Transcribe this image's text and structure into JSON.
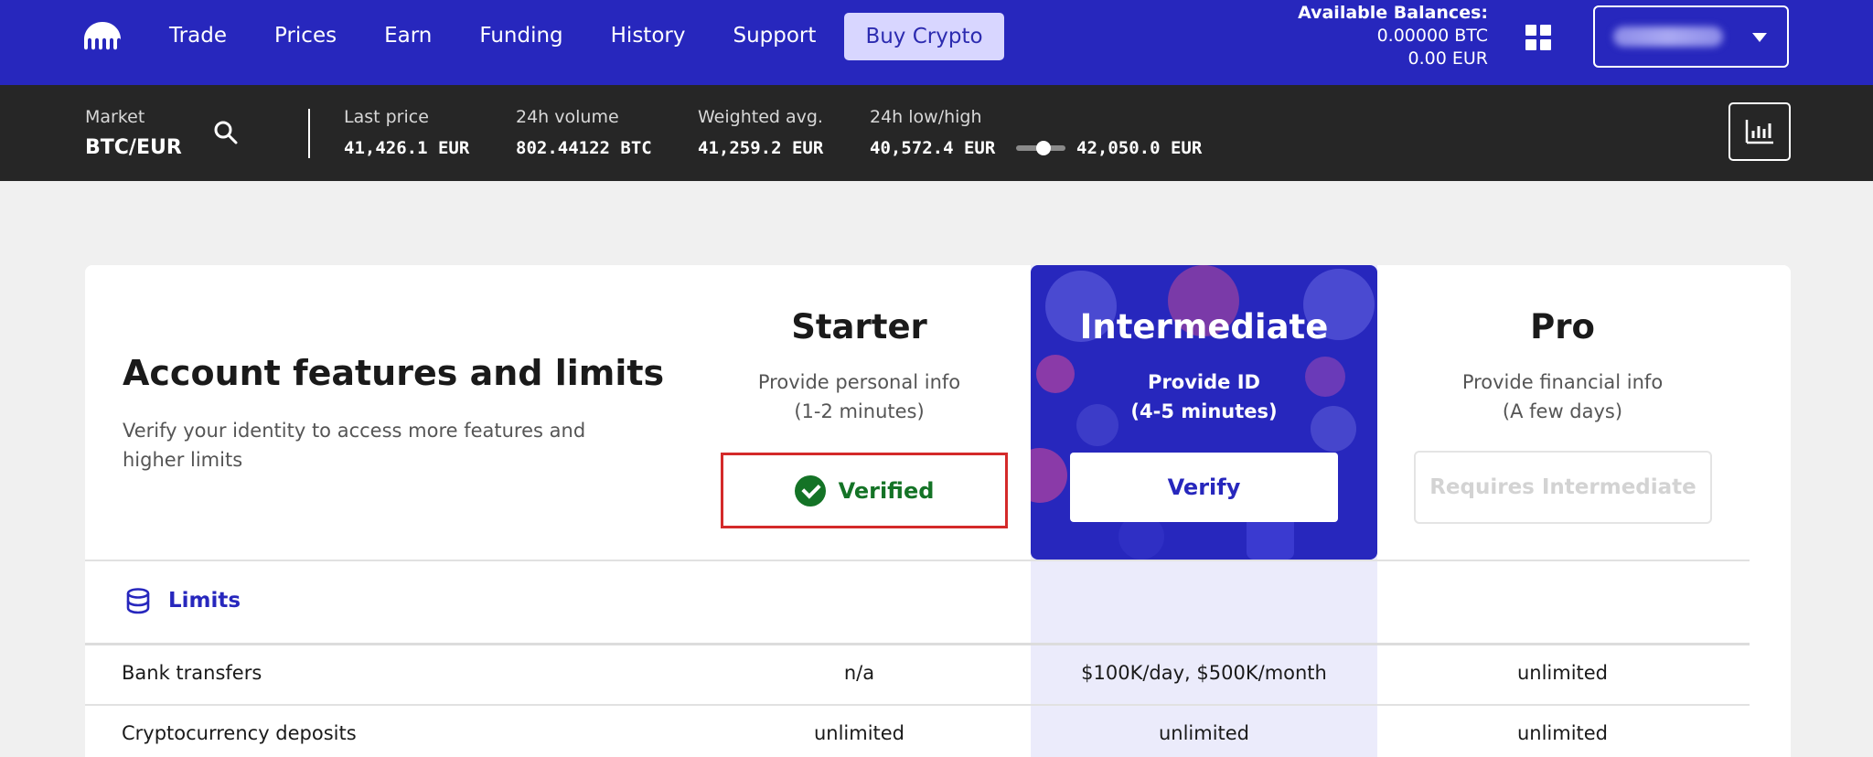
{
  "nav": {
    "links": [
      "Trade",
      "Prices",
      "Earn",
      "Funding",
      "History",
      "Support"
    ],
    "buy_label": "Buy Crypto",
    "balances": {
      "title": "Available Balances:",
      "btc": "0.00000 BTC",
      "eur": "0.00 EUR"
    }
  },
  "market": {
    "market_label": "Market",
    "pair": "BTC/EUR",
    "last_price": {
      "label": "Last price",
      "value": "41,426.1 EUR"
    },
    "volume": {
      "label": "24h volume",
      "value": "802.44122 BTC"
    },
    "weighted": {
      "label": "Weighted avg.",
      "value": "41,259.2 EUR"
    },
    "lowhigh": {
      "label": "24h low/high",
      "low": "40,572.4 EUR",
      "high": "42,050.0 EUR"
    }
  },
  "features": {
    "title": "Account features and limits",
    "subtitle": "Verify your identity to access more features and higher limits",
    "tiers": [
      {
        "name": "Starter",
        "desc1": "Provide personal info",
        "desc2": "(1-2 minutes)",
        "action": "Verified"
      },
      {
        "name": "Intermediate",
        "desc1": "Provide ID",
        "desc2": "(4-5 minutes)",
        "action": "Verify"
      },
      {
        "name": "Pro",
        "desc1": "Provide financial info",
        "desc2": "(A few days)",
        "action": "Requires Intermediate"
      }
    ],
    "limits_title": "Limits",
    "rows": [
      {
        "label": "Bank transfers",
        "starter": "n/a",
        "intermediate": "$100K/day, $500K/month",
        "pro": "unlimited"
      },
      {
        "label": "Cryptocurrency deposits",
        "starter": "unlimited",
        "intermediate": "unlimited",
        "pro": "unlimited"
      }
    ]
  },
  "colors": {
    "brand": "#2727bd",
    "market_bar": "#262626",
    "verified_green": "#147326",
    "highlight_border": "#d42a2a"
  }
}
